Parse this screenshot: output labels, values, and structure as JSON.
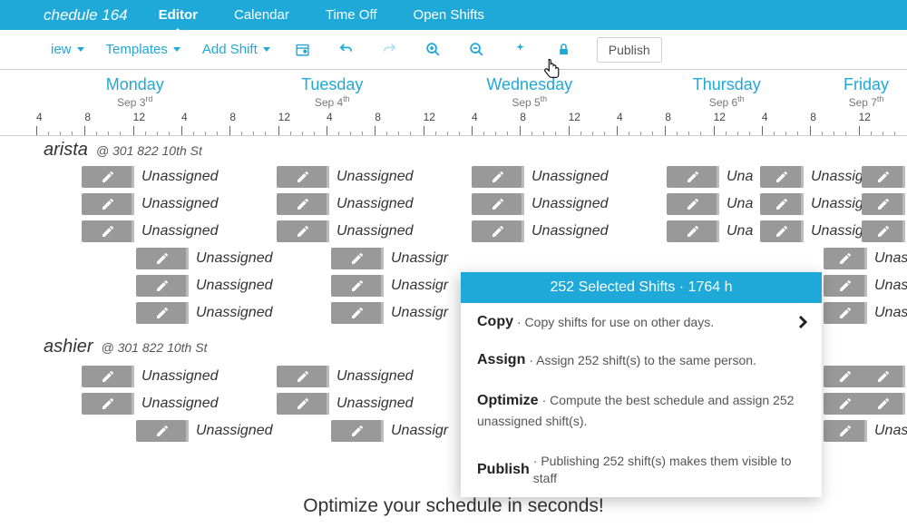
{
  "title": "chedule 164",
  "tabs": [
    "Editor",
    "Calendar",
    "Time Off",
    "Open Shifts"
  ],
  "active_tab": 0,
  "toolbar": {
    "view": "iew",
    "templates": "Templates",
    "add_shift": "Add Shift",
    "publish": "Publish"
  },
  "days": [
    {
      "name": "Monday",
      "date": "Sep 3",
      "ord": "rd"
    },
    {
      "name": "Tuesday",
      "date": "Sep 4",
      "ord": "th"
    },
    {
      "name": "Wednesday",
      "date": "Sep 5",
      "ord": "th"
    },
    {
      "name": "Thursday",
      "date": "Sep 6",
      "ord": "th"
    },
    {
      "name": "Friday",
      "date": "Sep 7",
      "ord": "th"
    }
  ],
  "hours": [
    "4",
    "8",
    "12",
    "4",
    "8",
    "12",
    "4",
    "8",
    "12",
    "4",
    "8",
    "12",
    "4",
    "8",
    "12",
    "4",
    "8",
    "12"
  ],
  "roles": [
    {
      "name": "arista",
      "location": "@ 301 822 10th St"
    },
    {
      "name": "ashier",
      "location": "@ 301 822 10th St"
    }
  ],
  "shift_label": "Unassigned",
  "shift_label_trunc": "Una",
  "shift_label_trunc2": "Unassigr",
  "shift_label_ned": "ned",
  "popup": {
    "header": "252 Selected Shifts · 1764 h",
    "items": [
      {
        "title": "Copy",
        "desc": "· Copy shifts for use on other days.",
        "chevron": true
      },
      {
        "title": "Assign",
        "desc": "· Assign 252 shift(s) to the same person."
      },
      {
        "title": "Optimize",
        "desc": "· Compute the best schedule and assign 252 unassigned shift(s)."
      },
      {
        "title": "Publish",
        "desc": "· Publishing 252 shift(s) makes them visible to staff"
      }
    ]
  },
  "caption": "Optimize your schedule in seconds!"
}
